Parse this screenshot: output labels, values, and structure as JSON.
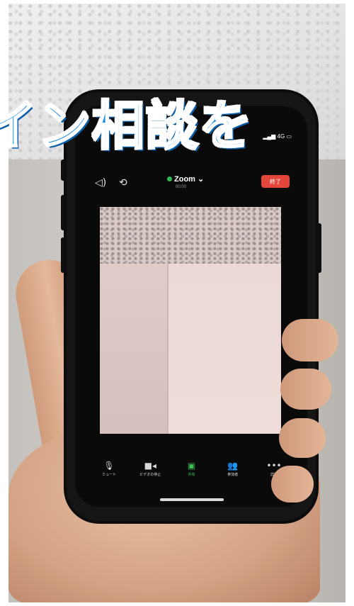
{
  "overlay": {
    "text": "イン相談を"
  },
  "zoom": {
    "title": "Zoom ⌄",
    "subtitle": "00:00",
    "end_label": "終了",
    "status": "4G"
  },
  "toolbar": {
    "items": [
      {
        "icon": "microphone-icon",
        "label": "ミュート"
      },
      {
        "icon": "video-camera-icon",
        "label": "ビデオの停止"
      },
      {
        "icon": "share-screen-icon",
        "label": "共有"
      },
      {
        "icon": "participants-icon",
        "label": "参加者"
      },
      {
        "icon": "more-icon",
        "label": "詳細"
      }
    ]
  },
  "colors": {
    "overlay_fill": "#1b8de0",
    "end_button": "#e5463c",
    "zoom_green": "#2fb84f"
  }
}
